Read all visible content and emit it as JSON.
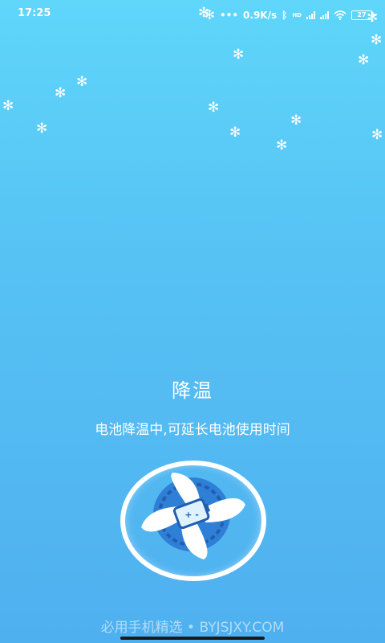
{
  "status_bar": {
    "time": "17:25",
    "network_speed": "0.9K/s",
    "hd_label": "HD",
    "battery": "27"
  },
  "main": {
    "title": "降温",
    "subtitle": "电池降温中,可延长电池使用时间"
  },
  "fan": {
    "battery_symbol": "+ -"
  },
  "footer": {
    "watermark": "必用手机精选 • BYJSJXY.COM"
  },
  "colors": {
    "background_top": "#5fd6fa",
    "background_bottom": "#4fb0ef",
    "fan_ring": "#ffffff",
    "fan_hub": "#2f7fd6"
  }
}
